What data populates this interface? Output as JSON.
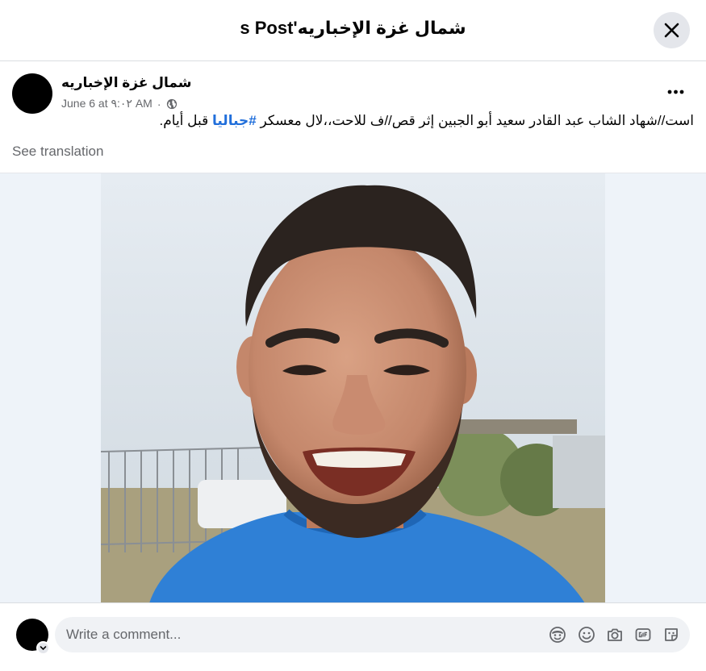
{
  "header": {
    "title": "شمال غزة الإخباريه's Post",
    "close_icon": "close-icon"
  },
  "post": {
    "author": "شمال غزة الإخباريه",
    "date": "June 6 at ٩:٠٢ AM",
    "separator": "·",
    "visibility_icon": "globe-icon",
    "more_icon": "more-options-icon",
    "text_main": "است//شهاد الشاب عبد القادر سعيد أبو الجبين إثر قص//ف للاحت،،لال معسكر ",
    "hashtag": "#جباليا",
    "text_end": " قبل أيام.",
    "see_translation": "See translation",
    "photo_alt": "portrait-photo"
  },
  "comment": {
    "placeholder": "Write a comment...",
    "tools": [
      "avatar-sticker-icon",
      "emoji-icon",
      "camera-icon",
      "gif-icon",
      "sticker-icon"
    ]
  }
}
